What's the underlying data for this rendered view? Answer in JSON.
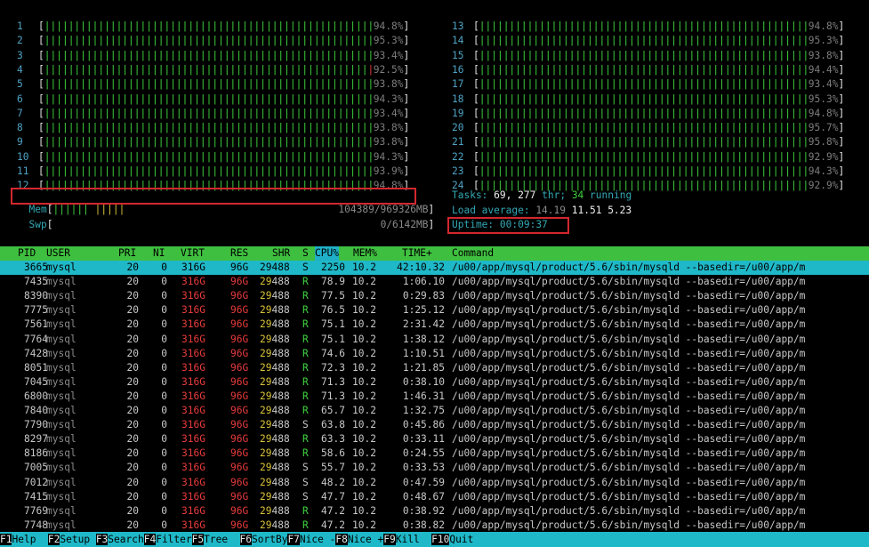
{
  "cpu_bars": {
    "left": [
      {
        "id": "1",
        "pct": "94.8%",
        "level": 94.8
      },
      {
        "id": "2",
        "pct": "95.3%",
        "level": 95.3
      },
      {
        "id": "3",
        "pct": "93.4%",
        "level": 93.4
      },
      {
        "id": "4",
        "pct": "92.5%",
        "level": 92.5
      },
      {
        "id": "5",
        "pct": "93.8%",
        "level": 93.8
      },
      {
        "id": "6",
        "pct": "94.3%",
        "level": 94.3
      },
      {
        "id": "7",
        "pct": "93.4%",
        "level": 93.4
      },
      {
        "id": "8",
        "pct": "93.8%",
        "level": 93.8
      },
      {
        "id": "9",
        "pct": "93.8%",
        "level": 93.8
      },
      {
        "id": "10",
        "pct": "94.3%",
        "level": 94.3
      },
      {
        "id": "11",
        "pct": "93.9%",
        "level": 93.9
      },
      {
        "id": "12",
        "pct": "94.8%",
        "level": 94.8
      }
    ],
    "right": [
      {
        "id": "13",
        "pct": "94.8%",
        "level": 94.8
      },
      {
        "id": "14",
        "pct": "95.3%",
        "level": 95.3
      },
      {
        "id": "15",
        "pct": "93.8%",
        "level": 93.8
      },
      {
        "id": "16",
        "pct": "94.4%",
        "level": 94.4
      },
      {
        "id": "17",
        "pct": "93.4%",
        "level": 93.4
      },
      {
        "id": "18",
        "pct": "95.3%",
        "level": 95.3
      },
      {
        "id": "19",
        "pct": "94.8%",
        "level": 94.8
      },
      {
        "id": "20",
        "pct": "95.7%",
        "level": 95.7
      },
      {
        "id": "21",
        "pct": "95.8%",
        "level": 95.8
      },
      {
        "id": "22",
        "pct": "92.9%",
        "level": 92.9
      },
      {
        "id": "23",
        "pct": "94.3%",
        "level": 94.3
      },
      {
        "id": "24",
        "pct": "92.9%",
        "level": 92.9
      }
    ]
  },
  "memory": {
    "label": "Mem",
    "value": "104389/969326MB",
    "level": 10.8
  },
  "swap": {
    "label": "Swp",
    "value": "0/6142MB",
    "level": 0
  },
  "tasks": {
    "label": "Tasks:",
    "count": "69,",
    "thr": "277",
    "thr_label": "thr;",
    "running": "34",
    "running_label": "running"
  },
  "load": {
    "label": "Load average:",
    "l1": "14.19",
    "l5": "11.51",
    "l15": "5.23"
  },
  "uptime": {
    "label": "Uptime:",
    "value": "00:09:37"
  },
  "columns": {
    "pid": "PID",
    "user": "USER",
    "pri": "PRI",
    "ni": "NI",
    "virt": "VIRT",
    "res": "RES",
    "shr": "SHR",
    "s": "S",
    "cpu": "CPU%",
    "mem": "MEM%",
    "time": "TIME+",
    "command": "Command"
  },
  "processes": [
    {
      "pid": "3665",
      "user": "mysql",
      "pri": "20",
      "ni": "0",
      "virt": "316G",
      "res": "96G",
      "shr": "29488",
      "s": "S",
      "cpu": "2250",
      "mem": "10.2",
      "time": "42:10.32",
      "command": "/u00/app/mysql/product/5.6/sbin/mysqld --basedir=/u00/app/m"
    },
    {
      "pid": "7435",
      "user": "mysql",
      "pri": "20",
      "ni": "0",
      "virt": "316G",
      "res": "96G",
      "shr": "29488",
      "s": "R",
      "cpu": "78.9",
      "mem": "10.2",
      "time": "1:06.10",
      "command": "/u00/app/mysql/product/5.6/sbin/mysqld --basedir=/u00/app/m"
    },
    {
      "pid": "8390",
      "user": "mysql",
      "pri": "20",
      "ni": "0",
      "virt": "316G",
      "res": "96G",
      "shr": "29488",
      "s": "R",
      "cpu": "77.5",
      "mem": "10.2",
      "time": "0:29.83",
      "command": "/u00/app/mysql/product/5.6/sbin/mysqld --basedir=/u00/app/m"
    },
    {
      "pid": "7775",
      "user": "mysql",
      "pri": "20",
      "ni": "0",
      "virt": "316G",
      "res": "96G",
      "shr": "29488",
      "s": "R",
      "cpu": "76.5",
      "mem": "10.2",
      "time": "1:25.12",
      "command": "/u00/app/mysql/product/5.6/sbin/mysqld --basedir=/u00/app/m"
    },
    {
      "pid": "7561",
      "user": "mysql",
      "pri": "20",
      "ni": "0",
      "virt": "316G",
      "res": "96G",
      "shr": "29488",
      "s": "R",
      "cpu": "75.1",
      "mem": "10.2",
      "time": "2:31.42",
      "command": "/u00/app/mysql/product/5.6/sbin/mysqld --basedir=/u00/app/m"
    },
    {
      "pid": "7764",
      "user": "mysql",
      "pri": "20",
      "ni": "0",
      "virt": "316G",
      "res": "96G",
      "shr": "29488",
      "s": "R",
      "cpu": "75.1",
      "mem": "10.2",
      "time": "1:38.12",
      "command": "/u00/app/mysql/product/5.6/sbin/mysqld --basedir=/u00/app/m"
    },
    {
      "pid": "7428",
      "user": "mysql",
      "pri": "20",
      "ni": "0",
      "virt": "316G",
      "res": "96G",
      "shr": "29488",
      "s": "R",
      "cpu": "74.6",
      "mem": "10.2",
      "time": "1:10.51",
      "command": "/u00/app/mysql/product/5.6/sbin/mysqld --basedir=/u00/app/m"
    },
    {
      "pid": "8051",
      "user": "mysql",
      "pri": "20",
      "ni": "0",
      "virt": "316G",
      "res": "96G",
      "shr": "29488",
      "s": "R",
      "cpu": "72.3",
      "mem": "10.2",
      "time": "1:21.85",
      "command": "/u00/app/mysql/product/5.6/sbin/mysqld --basedir=/u00/app/m"
    },
    {
      "pid": "7045",
      "user": "mysql",
      "pri": "20",
      "ni": "0",
      "virt": "316G",
      "res": "96G",
      "shr": "29488",
      "s": "R",
      "cpu": "71.3",
      "mem": "10.2",
      "time": "0:38.10",
      "command": "/u00/app/mysql/product/5.6/sbin/mysqld --basedir=/u00/app/m"
    },
    {
      "pid": "6800",
      "user": "mysql",
      "pri": "20",
      "ni": "0",
      "virt": "316G",
      "res": "96G",
      "shr": "29488",
      "s": "R",
      "cpu": "71.3",
      "mem": "10.2",
      "time": "1:46.31",
      "command": "/u00/app/mysql/product/5.6/sbin/mysqld --basedir=/u00/app/m"
    },
    {
      "pid": "7840",
      "user": "mysql",
      "pri": "20",
      "ni": "0",
      "virt": "316G",
      "res": "96G",
      "shr": "29488",
      "s": "R",
      "cpu": "65.7",
      "mem": "10.2",
      "time": "1:32.75",
      "command": "/u00/app/mysql/product/5.6/sbin/mysqld --basedir=/u00/app/m"
    },
    {
      "pid": "7790",
      "user": "mysql",
      "pri": "20",
      "ni": "0",
      "virt": "316G",
      "res": "96G",
      "shr": "29488",
      "s": "S",
      "cpu": "63.8",
      "mem": "10.2",
      "time": "0:45.86",
      "command": "/u00/app/mysql/product/5.6/sbin/mysqld --basedir=/u00/app/m"
    },
    {
      "pid": "8297",
      "user": "mysql",
      "pri": "20",
      "ni": "0",
      "virt": "316G",
      "res": "96G",
      "shr": "29488",
      "s": "R",
      "cpu": "63.3",
      "mem": "10.2",
      "time": "0:33.11",
      "command": "/u00/app/mysql/product/5.6/sbin/mysqld --basedir=/u00/app/m"
    },
    {
      "pid": "8186",
      "user": "mysql",
      "pri": "20",
      "ni": "0",
      "virt": "316G",
      "res": "96G",
      "shr": "29488",
      "s": "R",
      "cpu": "58.6",
      "mem": "10.2",
      "time": "0:24.55",
      "command": "/u00/app/mysql/product/5.6/sbin/mysqld --basedir=/u00/app/m"
    },
    {
      "pid": "7005",
      "user": "mysql",
      "pri": "20",
      "ni": "0",
      "virt": "316G",
      "res": "96G",
      "shr": "29488",
      "s": "S",
      "cpu": "55.7",
      "mem": "10.2",
      "time": "0:33.53",
      "command": "/u00/app/mysql/product/5.6/sbin/mysqld --basedir=/u00/app/m"
    },
    {
      "pid": "7012",
      "user": "mysql",
      "pri": "20",
      "ni": "0",
      "virt": "316G",
      "res": "96G",
      "shr": "29488",
      "s": "S",
      "cpu": "48.2",
      "mem": "10.2",
      "time": "0:47.59",
      "command": "/u00/app/mysql/product/5.6/sbin/mysqld --basedir=/u00/app/m"
    },
    {
      "pid": "7415",
      "user": "mysql",
      "pri": "20",
      "ni": "0",
      "virt": "316G",
      "res": "96G",
      "shr": "29488",
      "s": "S",
      "cpu": "47.7",
      "mem": "10.2",
      "time": "0:48.67",
      "command": "/u00/app/mysql/product/5.6/sbin/mysqld --basedir=/u00/app/m"
    },
    {
      "pid": "7769",
      "user": "mysql",
      "pri": "20",
      "ni": "0",
      "virt": "316G",
      "res": "96G",
      "shr": "29488",
      "s": "R",
      "cpu": "47.2",
      "mem": "10.2",
      "time": "0:38.92",
      "command": "/u00/app/mysql/product/5.6/sbin/mysqld --basedir=/u00/app/m"
    },
    {
      "pid": "7748",
      "user": "mysql",
      "pri": "20",
      "ni": "0",
      "virt": "316G",
      "res": "96G",
      "shr": "29488",
      "s": "R",
      "cpu": "47.2",
      "mem": "10.2",
      "time": "0:38.82",
      "command": "/u00/app/mysql/product/5.6/sbin/mysqld --basedir=/u00/app/m"
    }
  ],
  "footer": [
    {
      "key": "F1",
      "label": "Help  "
    },
    {
      "key": "F2",
      "label": "Setup "
    },
    {
      "key": "F3",
      "label": "Search"
    },
    {
      "key": "F4",
      "label": "Filter"
    },
    {
      "key": "F5",
      "label": "Tree  "
    },
    {
      "key": "F6",
      "label": "SortBy"
    },
    {
      "key": "F7",
      "label": "Nice -"
    },
    {
      "key": "F8",
      "label": "Nice +"
    },
    {
      "key": "F9",
      "label": "Kill  "
    },
    {
      "key": "F10",
      "label": "Quit"
    }
  ],
  "colors": {
    "bar_green": "#3fd23f",
    "bar_red": "#e83b3b",
    "accent": "#1fb8c8",
    "header": "#3fbf3f",
    "highlight_box": "#d2282e"
  }
}
